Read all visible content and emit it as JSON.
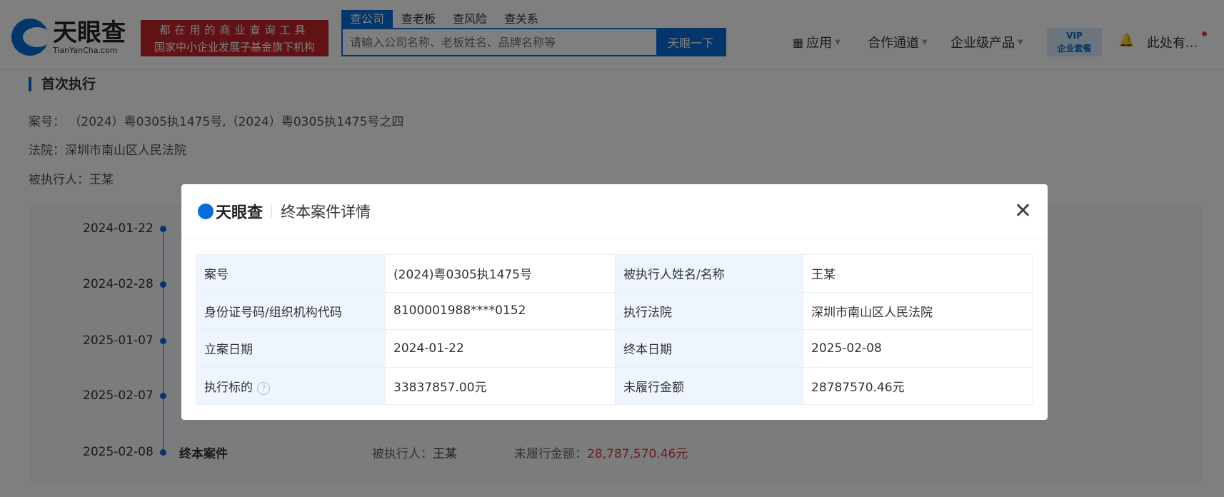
{
  "header": {
    "logo_text": "天眼查",
    "logo_sub": "TianYanCha.com",
    "banner_line1": "都在用的商业查询工具",
    "banner_line2": "国家中小企业发展子基金旗下机构",
    "search_tabs": [
      "查公司",
      "查老板",
      "查风险",
      "查关系"
    ],
    "search_placeholder": "请输入公司名称、老板姓名、品牌名称等",
    "search_button": "天眼一下",
    "nav": {
      "apps": "应用",
      "partner": "合作通道",
      "enterprise": "企业级产品",
      "vip_top": "VIP",
      "vip_bottom": "企业套餐",
      "user": "此处有..."
    }
  },
  "page": {
    "section_title": "首次执行",
    "case_no": "案号： （2024）粤0305执1475号,（2024）粤0305执1475号之四",
    "court": "法院：深圳市南山区人民法院",
    "executed": "被执行人：王某",
    "timeline": [
      {
        "date": "2024-01-22"
      },
      {
        "date": "2024-02-28"
      },
      {
        "date": "2025-01-07"
      },
      {
        "date": "2025-02-07"
      },
      {
        "date": "2025-02-08",
        "title": "终本案件",
        "person_label": "被执行人：",
        "person": "王某",
        "amount_label": "未履行金额：",
        "amount": "28,787,570.46元"
      }
    ]
  },
  "modal": {
    "logo_text": "天眼查",
    "title": "终本案件详情",
    "rows": [
      {
        "k1": "案号",
        "v1": "(2024)粤0305执1475号",
        "k2": "被执行人姓名/名称",
        "v2": "王某"
      },
      {
        "k1": "身份证号码/组织机构代码",
        "v1": "8100001988****0152",
        "k2": "执行法院",
        "v2": "深圳市南山区人民法院"
      },
      {
        "k1": "立案日期",
        "v1": "2024-01-22",
        "k2": "终本日期",
        "v2": "2025-02-08"
      },
      {
        "k1": "执行标的",
        "v1": "33837857.00元",
        "k2": "未履行金额",
        "v2": "28787570.46元"
      }
    ]
  },
  "colors": {
    "brand": "#0a6cd6",
    "banner": "#c0242a",
    "amount": "#e03c3c"
  }
}
